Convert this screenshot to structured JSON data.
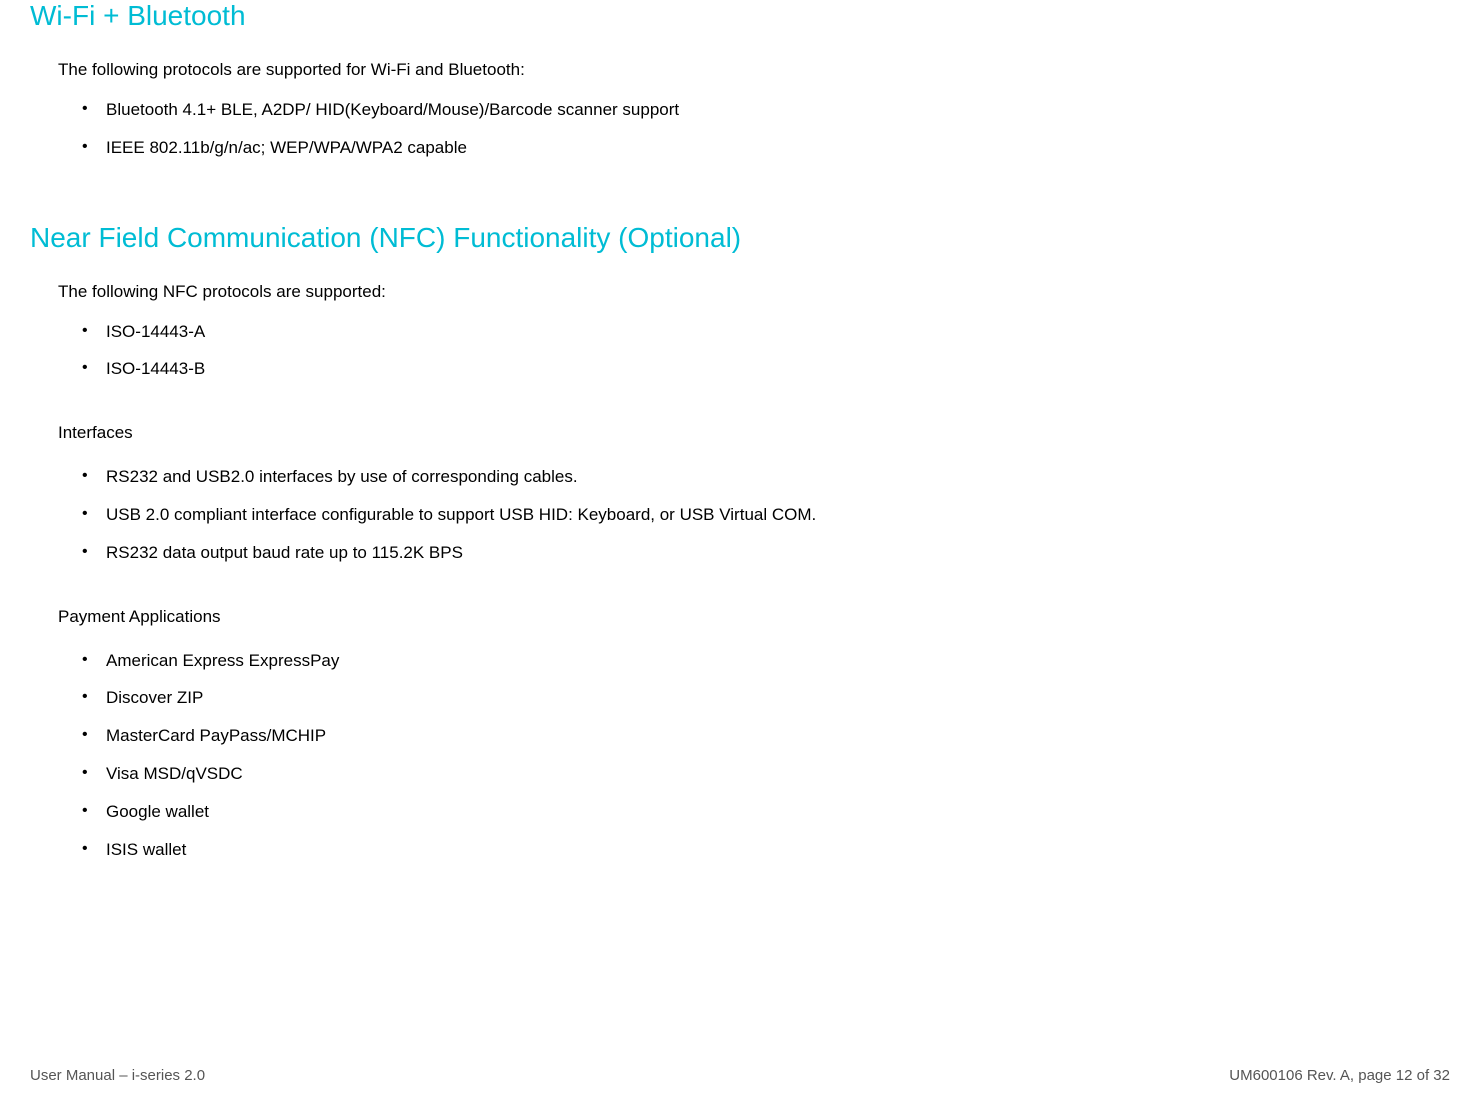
{
  "section1": {
    "heading": "Wi-Fi + Bluetooth",
    "intro": "The following protocols are supported for Wi-Fi and Bluetooth:",
    "items": [
      "Bluetooth 4.1+ BLE, A2DP/ HID(Keyboard/Mouse)/Barcode scanner support",
      "IEEE 802.11b/g/n/ac; WEP/WPA/WPA2 capable"
    ]
  },
  "section2": {
    "heading": "Near Field Communication (NFC) Functionality (Optional)",
    "intro": "The following NFC protocols are supported:",
    "items": [
      "ISO-14443-A",
      "ISO-14443-B"
    ],
    "sub1": {
      "heading": "Interfaces",
      "items": [
        "RS232 and USB2.0 interfaces by use of corresponding cables.",
        "USB 2.0 compliant interface configurable to support USB HID: Keyboard, or USB Virtual COM.",
        "RS232 data output baud rate up to 115.2K BPS"
      ]
    },
    "sub2": {
      "heading": "Payment Applications",
      "items": [
        "American Express ExpressPay",
        "Discover ZIP",
        "MasterCard PayPass/MCHIP",
        "Visa MSD/qVSDC",
        "Google wallet",
        "ISIS wallet"
      ]
    }
  },
  "footer": {
    "left": "User Manual – i-series 2.0",
    "right": "UM600106 Rev. A, page 12 of 32"
  }
}
